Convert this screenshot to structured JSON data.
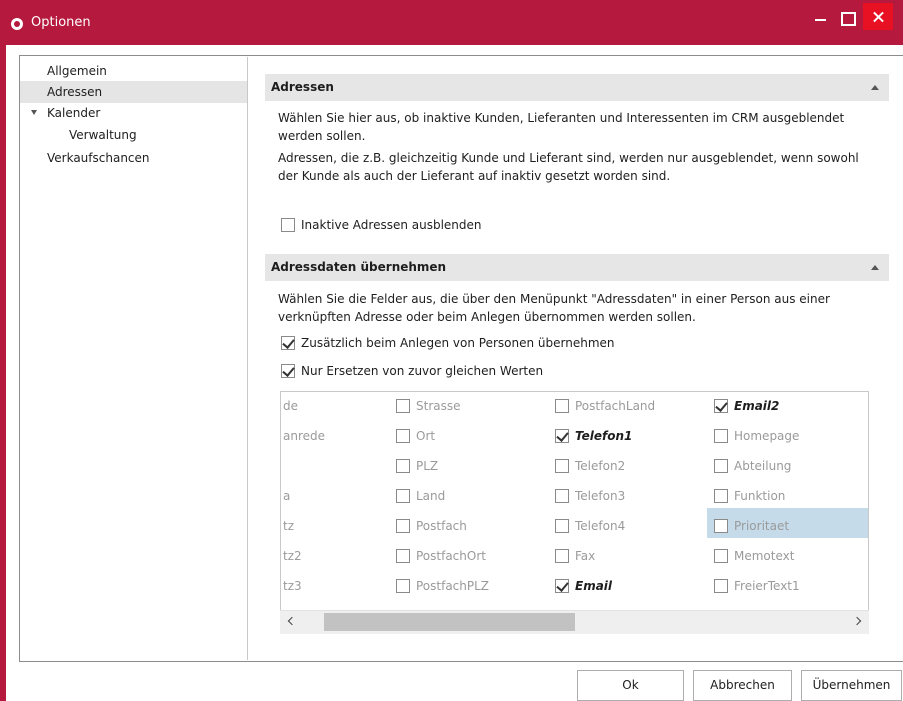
{
  "window": {
    "title": "Optionen"
  },
  "nav": {
    "items": [
      {
        "label": "Allgemein"
      },
      {
        "label": "Adressen"
      },
      {
        "label": "Kalender"
      },
      {
        "label": "Verwaltung"
      },
      {
        "label": "Verkaufschancen"
      }
    ],
    "selected": "Adressen"
  },
  "adressen": {
    "header": "Adressen",
    "text1": "Wählen Sie hier aus, ob inaktive Kunden, Lieferanten und Interessenten im CRM ausgeblendet werden sollen.",
    "text2": "Adressen, die z.B. gleichzeitig Kunde und Lieferant sind, werden nur ausgeblendet, wenn sowohl der Kunde als auch der Lieferant auf inaktiv gesetzt worden sind.",
    "hide_inactive": {
      "label": "Inaktive Adressen ausblenden",
      "checked": false
    }
  },
  "adressdaten": {
    "header": "Adressdaten übernehmen",
    "text": "Wählen Sie die Felder aus, die über den Menüpunkt \"Adressdaten\" in einer Person aus einer verknüpften Adresse oder beim Anlegen übernommen werden sollen.",
    "on_create": {
      "label": "Zusätzlich beim Anlegen von Personen übernehmen",
      "checked": true
    },
    "replace_equal": {
      "label": "Nur Ersetzen von zuvor gleichen Werten",
      "checked": true
    },
    "clipped_column": [
      "de",
      "anrede",
      "",
      "a",
      "tz",
      "tz2",
      "tz3"
    ],
    "columns": [
      [
        {
          "label": "Strasse",
          "checked": false
        },
        {
          "label": "Ort",
          "checked": false
        },
        {
          "label": "PLZ",
          "checked": false
        },
        {
          "label": "Land",
          "checked": false
        },
        {
          "label": "Postfach",
          "checked": false
        },
        {
          "label": "PostfachOrt",
          "checked": false
        },
        {
          "label": "PostfachPLZ",
          "checked": false
        }
      ],
      [
        {
          "label": "PostfachLand",
          "checked": false
        },
        {
          "label": "Telefon1",
          "checked": true
        },
        {
          "label": "Telefon2",
          "checked": false
        },
        {
          "label": "Telefon3",
          "checked": false
        },
        {
          "label": "Telefon4",
          "checked": false
        },
        {
          "label": "Fax",
          "checked": false
        },
        {
          "label": "Email",
          "checked": true
        }
      ],
      [
        {
          "label": "Email2",
          "checked": true
        },
        {
          "label": "Homepage",
          "checked": false
        },
        {
          "label": "Abteilung",
          "checked": false
        },
        {
          "label": "Funktion",
          "checked": false
        },
        {
          "label": "Prioritaet",
          "checked": false
        },
        {
          "label": "Memotext",
          "checked": false
        },
        {
          "label": "FreierText1",
          "checked": false
        }
      ]
    ],
    "highlighted_field": "Prioritaet"
  },
  "buttons": {
    "ok": "Ok",
    "cancel": "Abbrechen",
    "apply": "Übernehmen"
  },
  "colors": {
    "titlebar": "#b5193e",
    "close": "#e81123",
    "selection": "#c6dbea"
  }
}
